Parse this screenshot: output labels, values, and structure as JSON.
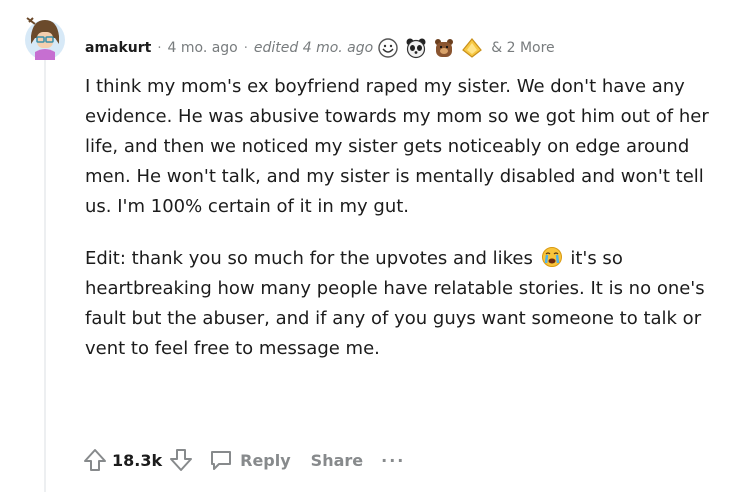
{
  "comment": {
    "username": "amakurt",
    "time": "4 mo. ago",
    "edited": "edited 4 mo. ago",
    "more_awards": "& 2 More",
    "awards": [
      "grin-face-award-icon",
      "panda-face-award-icon",
      "bear-award-icon",
      "gold-trophy-award-icon"
    ],
    "paragraph1": "I think my mom's ex boyfriend raped my sister. We don't have any evidence. He was abusive towards my mom so we got him out of her life, and then we noticed my sister gets noticeably on edge around men. He won't talk, and my sister is mentally disabled and won't tell us. I'm 100% certain of it in my gut.",
    "paragraph2_a": "Edit: thank you so much for the upvotes and likes",
    "paragraph2_b": "it's so heartbreaking how many people have relatable stories. It is no one's fault but the abuser, and if any of you guys want someone to talk or vent to feel free to message me.",
    "emoji": "crying-face-emoji-icon"
  },
  "actions": {
    "score": "18.3k",
    "reply_label": "Reply",
    "share_label": "Share",
    "more_label": "···"
  },
  "colors": {
    "text": "#1c1c1c",
    "meta": "#787c7e",
    "icon": "#878a8c",
    "thread_line": "#edeff1"
  }
}
